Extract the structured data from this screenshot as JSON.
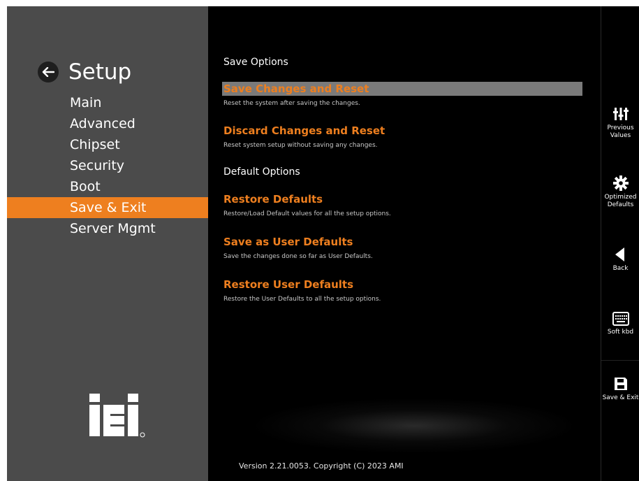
{
  "sidebar": {
    "title": "Setup",
    "menu": [
      {
        "label": "Main"
      },
      {
        "label": "Advanced"
      },
      {
        "label": "Chipset"
      },
      {
        "label": "Security"
      },
      {
        "label": "Boot"
      },
      {
        "label": "Save & Exit",
        "active": true
      },
      {
        "label": "Server Mgmt"
      }
    ],
    "logo_text": "iEi"
  },
  "main": {
    "save_options_header": "Save Options",
    "default_options_header": "Default Options",
    "options": [
      {
        "title": "Save Changes and Reset",
        "desc": "Reset the system after saving the changes.",
        "selected": true
      },
      {
        "title": "Discard Changes and Reset",
        "desc": "Reset system setup without saving any changes."
      },
      {
        "title": "Restore Defaults",
        "desc": "Restore/Load Default values for all the setup options."
      },
      {
        "title": "Save as User Defaults",
        "desc": "Save the changes done so far as User Defaults."
      },
      {
        "title": "Restore User Defaults",
        "desc": "Restore the User Defaults to all the setup options."
      }
    ],
    "version": "Version 2.21.0053. Copyright (C) 2023 AMI"
  },
  "toolbar": {
    "items": [
      {
        "label_line1": "Previous",
        "label_line2": "Values",
        "icon": "sliders-icon"
      },
      {
        "label_line1": "Optimized",
        "label_line2": "Defaults",
        "icon": "gear-icon"
      },
      {
        "label_line1": "Back",
        "label_line2": "",
        "icon": "back-arrow-icon"
      },
      {
        "label_line1": "Soft kbd",
        "label_line2": "",
        "icon": "keyboard-icon"
      },
      {
        "label_line1": "Save & Exit",
        "label_line2": "",
        "icon": "floppy-icon"
      }
    ]
  },
  "colors": {
    "accent": "#ee7f1f",
    "sidebar_bg": "#4b4b4b",
    "selected_bg": "#7a7a7a"
  }
}
